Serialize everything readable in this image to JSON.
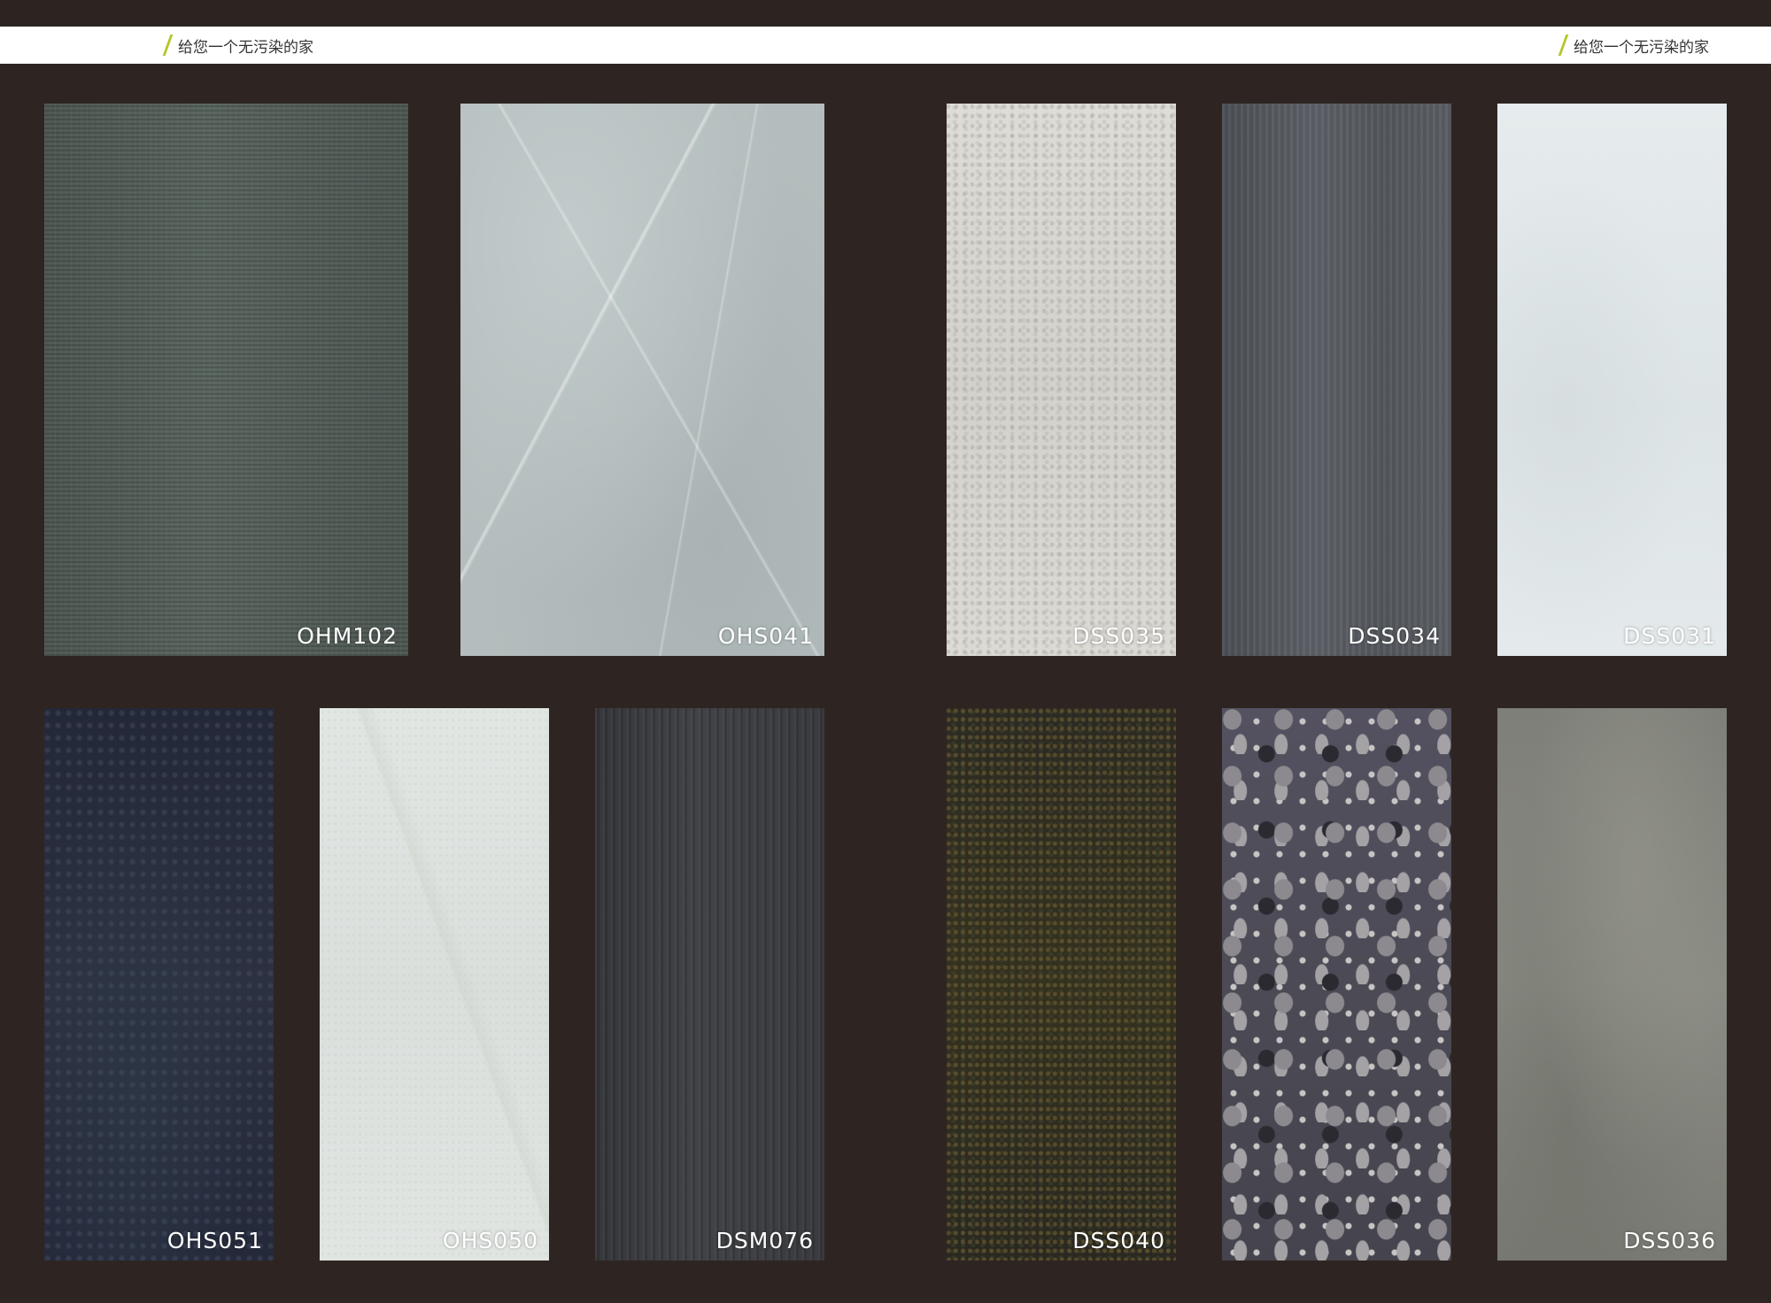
{
  "header": {
    "tagline_left": "给您一个无污染的家",
    "tagline_right": "给您一个无污染的家",
    "accent_color": "#b5c72a"
  },
  "swatches": {
    "row1": [
      "OHM102",
      "OHS041",
      "DSS035",
      "DSS034",
      "DSS031"
    ],
    "row2": [
      "OHS051",
      "OHS050",
      "DSM076",
      "DSS040",
      "",
      "DSS036"
    ]
  }
}
